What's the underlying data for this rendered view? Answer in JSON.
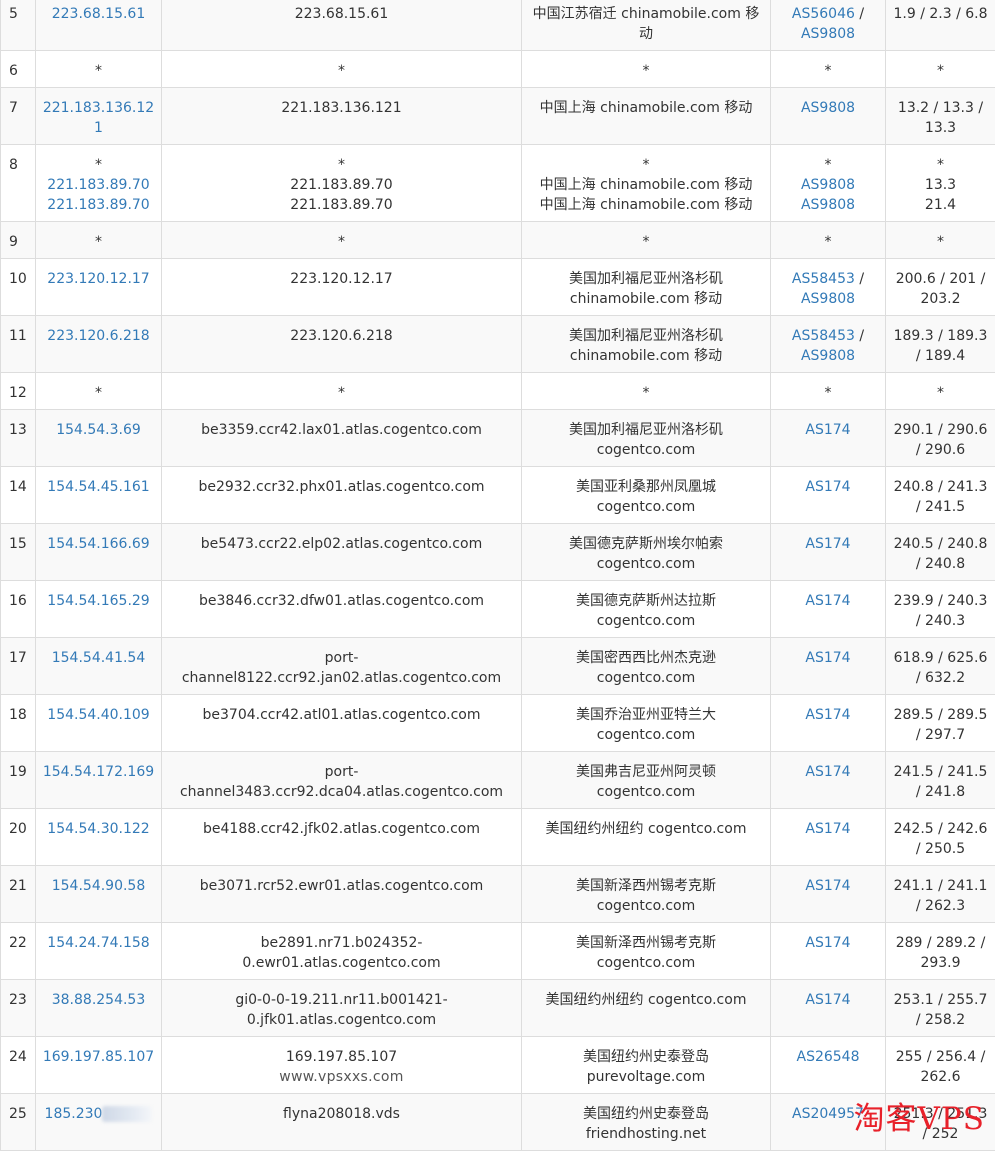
{
  "rows": [
    {
      "hop": "5",
      "ips": [
        "223.68.15.61"
      ],
      "hosts": [
        "223.68.15.61"
      ],
      "locs": [
        "中国江苏宿迁 chinamobile.com 移动"
      ],
      "asns": [
        "AS56046",
        "AS9808"
      ],
      "rtt": "1.9 / 2.3 / 6.8",
      "shade": "odd"
    },
    {
      "hop": "6",
      "ips": [
        "*"
      ],
      "hosts": [
        "*"
      ],
      "locs": [
        "*"
      ],
      "asns": [
        "*"
      ],
      "rtt": "*",
      "shade": "even"
    },
    {
      "hop": "7",
      "ips": [
        "221.183.136.121"
      ],
      "hosts": [
        "221.183.136.121"
      ],
      "locs": [
        "中国上海 chinamobile.com 移动"
      ],
      "asns": [
        "AS9808"
      ],
      "rtt": "13.2 / 13.3 / 13.3",
      "shade": "odd"
    },
    {
      "hop": "8",
      "ips": [
        "*",
        "221.183.89.70",
        "221.183.89.70"
      ],
      "hosts": [
        "*",
        "221.183.89.70",
        "221.183.89.70"
      ],
      "locs": [
        "*",
        "中国上海 chinamobile.com 移动",
        "中国上海 chinamobile.com 移动"
      ],
      "asns": [
        "*",
        "AS9808",
        "AS9808"
      ],
      "rtt_lines": [
        "*",
        "13.3",
        "21.4"
      ],
      "shade": "even"
    },
    {
      "hop": "9",
      "ips": [
        "*"
      ],
      "hosts": [
        "*"
      ],
      "locs": [
        "*"
      ],
      "asns": [
        "*"
      ],
      "rtt": "*",
      "shade": "odd"
    },
    {
      "hop": "10",
      "ips": [
        "223.120.12.17"
      ],
      "hosts": [
        "223.120.12.17"
      ],
      "locs": [
        "美国加利福尼亚州洛杉矶 chinamobile.com 移动"
      ],
      "asns": [
        "AS58453",
        "AS9808"
      ],
      "rtt": "200.6 / 201 / 203.2",
      "shade": "even"
    },
    {
      "hop": "11",
      "ips": [
        "223.120.6.218"
      ],
      "hosts": [
        "223.120.6.218"
      ],
      "locs": [
        "美国加利福尼亚州洛杉矶 chinamobile.com 移动"
      ],
      "asns": [
        "AS58453",
        "AS9808"
      ],
      "rtt": "189.3 / 189.3 / 189.4",
      "shade": "odd"
    },
    {
      "hop": "12",
      "ips": [
        "*"
      ],
      "hosts": [
        "*"
      ],
      "locs": [
        "*"
      ],
      "asns": [
        "*"
      ],
      "rtt": "*",
      "shade": "even"
    },
    {
      "hop": "13",
      "ips": [
        "154.54.3.69"
      ],
      "hosts": [
        "be3359.ccr42.lax01.atlas.cogentco.com"
      ],
      "locs": [
        "美国加利福尼亚州洛杉矶 cogentco.com"
      ],
      "asns": [
        "AS174"
      ],
      "rtt": "290.1 / 290.6 / 290.6",
      "shade": "odd"
    },
    {
      "hop": "14",
      "ips": [
        "154.54.45.161"
      ],
      "hosts": [
        "be2932.ccr32.phx01.atlas.cogentco.com"
      ],
      "locs": [
        "美国亚利桑那州凤凰城 cogentco.com"
      ],
      "asns": [
        "AS174"
      ],
      "rtt": "240.8 / 241.3 / 241.5",
      "shade": "even"
    },
    {
      "hop": "15",
      "ips": [
        "154.54.166.69"
      ],
      "hosts": [
        "be5473.ccr22.elp02.atlas.cogentco.com"
      ],
      "locs": [
        "美国德克萨斯州埃尔帕索 cogentco.com"
      ],
      "asns": [
        "AS174"
      ],
      "rtt": "240.5 / 240.8 / 240.8",
      "shade": "odd"
    },
    {
      "hop": "16",
      "ips": [
        "154.54.165.29"
      ],
      "hosts": [
        "be3846.ccr32.dfw01.atlas.cogentco.com"
      ],
      "locs": [
        "美国德克萨斯州达拉斯 cogentco.com"
      ],
      "asns": [
        "AS174"
      ],
      "rtt": "239.9 / 240.3 / 240.3",
      "shade": "even"
    },
    {
      "hop": "17",
      "ips": [
        "154.54.41.54"
      ],
      "hosts": [
        "port-channel8122.ccr92.jan02.atlas.cogentco.com"
      ],
      "locs": [
        "美国密西西比州杰克逊 cogentco.com"
      ],
      "asns": [
        "AS174"
      ],
      "rtt": "618.9 / 625.6 / 632.2",
      "shade": "odd"
    },
    {
      "hop": "18",
      "ips": [
        "154.54.40.109"
      ],
      "hosts": [
        "be3704.ccr42.atl01.atlas.cogentco.com"
      ],
      "locs": [
        "美国乔治亚州亚特兰大 cogentco.com"
      ],
      "asns": [
        "AS174"
      ],
      "rtt": "289.5 / 289.5 / 297.7",
      "shade": "even"
    },
    {
      "hop": "19",
      "ips": [
        "154.54.172.169"
      ],
      "hosts": [
        "port-channel3483.ccr92.dca04.atlas.cogentco.com"
      ],
      "locs": [
        "美国弗吉尼亚州阿灵顿 cogentco.com"
      ],
      "asns": [
        "AS174"
      ],
      "rtt": "241.5 / 241.5 / 241.8",
      "shade": "odd"
    },
    {
      "hop": "20",
      "ips": [
        "154.54.30.122"
      ],
      "hosts": [
        "be4188.ccr42.jfk02.atlas.cogentco.com"
      ],
      "locs": [
        "美国纽约州纽约 cogentco.com"
      ],
      "asns": [
        "AS174"
      ],
      "rtt": "242.5 / 242.6 / 250.5",
      "shade": "even"
    },
    {
      "hop": "21",
      "ips": [
        "154.54.90.58"
      ],
      "hosts": [
        "be3071.rcr52.ewr01.atlas.cogentco.com"
      ],
      "locs": [
        "美国新泽西州锡考克斯 cogentco.com"
      ],
      "asns": [
        "AS174"
      ],
      "rtt": "241.1 / 241.1 / 262.3",
      "shade": "odd"
    },
    {
      "hop": "22",
      "ips": [
        "154.24.74.158"
      ],
      "hosts": [
        "be2891.nr71.b024352-0.ewr01.atlas.cogentco.com"
      ],
      "locs": [
        "美国新泽西州锡考克斯 cogentco.com"
      ],
      "asns": [
        "AS174"
      ],
      "rtt": "289 / 289.2 / 293.9",
      "shade": "even"
    },
    {
      "hop": "23",
      "ips": [
        "38.88.254.53"
      ],
      "hosts": [
        "gi0-0-0-19.211.nr11.b001421-0.jfk01.atlas.cogentco.com"
      ],
      "locs": [
        "美国纽约州纽约 cogentco.com"
      ],
      "asns": [
        "AS174"
      ],
      "rtt": "253.1 / 255.7 / 258.2",
      "shade": "odd"
    },
    {
      "hop": "24",
      "ips": [
        "169.197.85.107"
      ],
      "hosts": [
        "169.197.85.107"
      ],
      "host_sub": "www.vpsxxs.com",
      "locs": [
        "美国纽约州史泰登岛 purevoltage.com"
      ],
      "asns": [
        "AS26548"
      ],
      "rtt": "255 / 256.4 / 262.6",
      "shade": "even"
    },
    {
      "hop": "25",
      "ips": [
        "185.230"
      ],
      "ip_blurred": true,
      "hosts": [
        "flyna208018.vds"
      ],
      "locs": [
        "美国纽约州史泰登岛 friendhosting.net"
      ],
      "asns": [
        "AS204957"
      ],
      "rtt": "251.3 / 251.3 / 252",
      "shade": "odd"
    }
  ],
  "watermark": "淘客VPS"
}
